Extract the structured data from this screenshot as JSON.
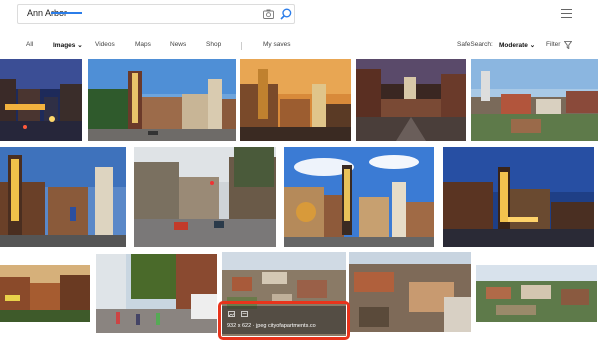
{
  "search": {
    "value": "Ann Arbor"
  },
  "nav": {
    "tabs": [
      {
        "label": "All"
      },
      {
        "label": "Images"
      },
      {
        "label": "Videos"
      },
      {
        "label": "Maps"
      },
      {
        "label": "News"
      },
      {
        "label": "Shop"
      }
    ],
    "images_chevron": "⌄",
    "my_saves": "My saves",
    "safesearch_label": "SafeSearch:",
    "safesearch_value": "Moderate",
    "safesearch_chevron": "⌄",
    "filter_label": "Filter"
  },
  "hover_info": {
    "text": "932 x 622 · jpeg  cityofapartments.co"
  },
  "colors": {
    "accent": "#2b7de9",
    "highlight": "#e8341c"
  }
}
